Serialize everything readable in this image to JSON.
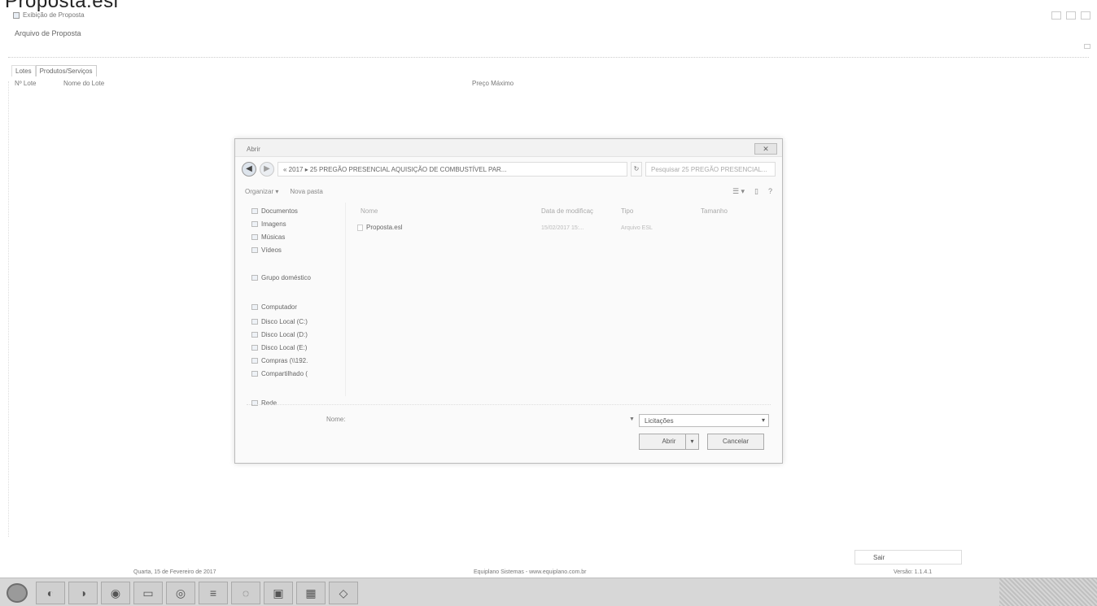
{
  "overlay_title": "Proposta.esl",
  "app": {
    "title": "Exibição de Proposta",
    "subtitle": "Arquivo de Proposta"
  },
  "tabs": [
    "Lotes",
    "Produtos/Serviços"
  ],
  "columns": {
    "lote": "Nº Lote",
    "nome": "Nome do Lote",
    "preco": "Preço Máximo"
  },
  "dialog": {
    "title": "Abrir",
    "address": "« 2017 ▸ 25 PREGÃO PRESENCIAL AQUISIÇÃO DE COMBUSTÍVEL PAR...",
    "search_placeholder": "Pesquisar 25 PREGÃO PRESENCIAL...",
    "toolbar": {
      "organize": "Organizar ▾",
      "new_folder": "Nova pasta"
    },
    "nav_items": [
      "Documentos",
      "Imagens",
      "Músicas",
      "Vídeos",
      "Grupo doméstico",
      "Computador",
      "Disco Local (C:)",
      "Disco Local (D:)",
      "Disco Local (E:)",
      "Compras (\\\\192.",
      "Compartilhado (",
      "Rede"
    ],
    "list_headers": {
      "name": "Nome",
      "date": "Data de modificaç",
      "type": "Tipo",
      "size": "Tamanho"
    },
    "files": [
      {
        "name": "Proposta.esl",
        "date": "15/02/2017 15:...",
        "type": "Arquivo ESL"
      }
    ],
    "name_label": "Nome:",
    "filter": "Licitações",
    "open_label": "Abrir",
    "cancel_label": "Cancelar"
  },
  "bottom": {
    "sair": "Sair",
    "date_text": "Quarta, 15 de Fevereiro de 2017",
    "company_text": "Equiplano Sistemas - www.equiplano.com.br",
    "version_text": "Versão: 1.1.4.1"
  }
}
